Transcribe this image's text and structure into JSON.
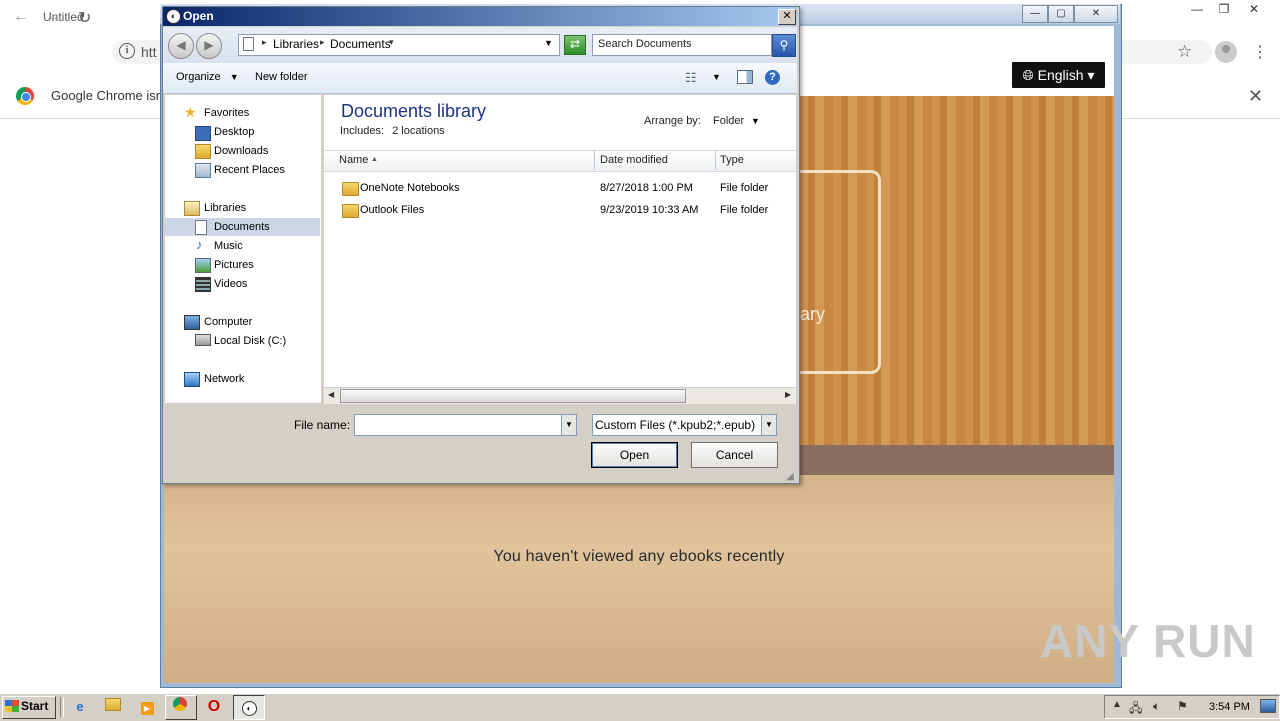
{
  "chrome": {
    "tab_title": "Untitled",
    "omnibox_text": "htt",
    "infobar_text": "Google Chrome isn't",
    "infobar_close": "✕"
  },
  "app": {
    "language_button": "English",
    "library_card_label": "ary",
    "empty_message": "You haven't viewed any ebooks recently"
  },
  "dialog": {
    "title": "Open",
    "close": "✕",
    "breadcrumbs": [
      "Libraries",
      "Documents"
    ],
    "search_placeholder": "Search Documents",
    "toolbar": {
      "organize": "Organize",
      "new_folder": "New folder",
      "help": "?"
    },
    "nav": {
      "favorites": "Favorites",
      "desktop": "Desktop",
      "downloads": "Downloads",
      "recent_places": "Recent Places",
      "libraries": "Libraries",
      "documents": "Documents",
      "music": "Music",
      "pictures": "Pictures",
      "videos": "Videos",
      "computer": "Computer",
      "local_disk": "Local Disk (C:)",
      "network": "Network"
    },
    "library_title": "Documents library",
    "library_includes_label": "Includes:",
    "library_includes_value": "2 locations",
    "arrange_by_label": "Arrange by:",
    "arrange_by_value": "Folder",
    "columns": {
      "name": "Name",
      "date_modified": "Date modified",
      "type": "Type"
    },
    "files": [
      {
        "name": "OneNote Notebooks",
        "date": "8/27/2018 1:00 PM",
        "type": "File folder"
      },
      {
        "name": "Outlook Files",
        "date": "9/23/2019 10:33 AM",
        "type": "File folder"
      }
    ],
    "file_name_label": "File name:",
    "file_name_value": "",
    "filter_value": "Custom Files (*.kpub2;*.epub)",
    "open_button": "Open",
    "cancel_button": "Cancel"
  },
  "watermark": "ANY RUN",
  "taskbar": {
    "start": "Start",
    "clock": "3:54 PM"
  }
}
